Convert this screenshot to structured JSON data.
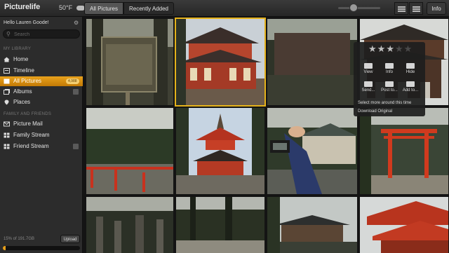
{
  "app": {
    "name": "Picturelife"
  },
  "weather": {
    "temp": "50°F"
  },
  "tabs": [
    {
      "label": "All Pictures"
    },
    {
      "label": "Recently Added"
    }
  ],
  "header": {
    "info_label": "Info"
  },
  "sidebar": {
    "greeting": "Hello Lauren Goode!",
    "search_placeholder": "Search",
    "library_title": "MY LIBRARY",
    "library": [
      {
        "label": "Home",
        "icon": "home-icon"
      },
      {
        "label": "Timeline",
        "icon": "timeline-icon"
      },
      {
        "label": "All Pictures",
        "icon": "all-pictures-icon",
        "badge": "4,988",
        "active": true
      },
      {
        "label": "Albums",
        "icon": "albums-icon"
      },
      {
        "label": "Places",
        "icon": "pin-icon"
      }
    ],
    "family_title": "FAMILY AND FRIENDS",
    "family": [
      {
        "label": "Picture Mail",
        "icon": "mail-icon"
      },
      {
        "label": "Family Stream",
        "icon": "grid-icon"
      },
      {
        "label": "Friend Stream",
        "icon": "grid-icon"
      }
    ],
    "usage": "15% of 191.7GB",
    "upload_label": "Upload",
    "storage_fraction": 0.04
  },
  "menu": {
    "rating": 3,
    "max_rating": 5,
    "row1": [
      "View",
      "Info",
      "Hide"
    ],
    "row2": [
      "Send...",
      "Post to...",
      "Add to..."
    ],
    "more_label": "Select more around this time",
    "download_label": "Download Original"
  },
  "colors": {
    "accent": "#e5a21b",
    "selected_border": "#e5b21b"
  }
}
